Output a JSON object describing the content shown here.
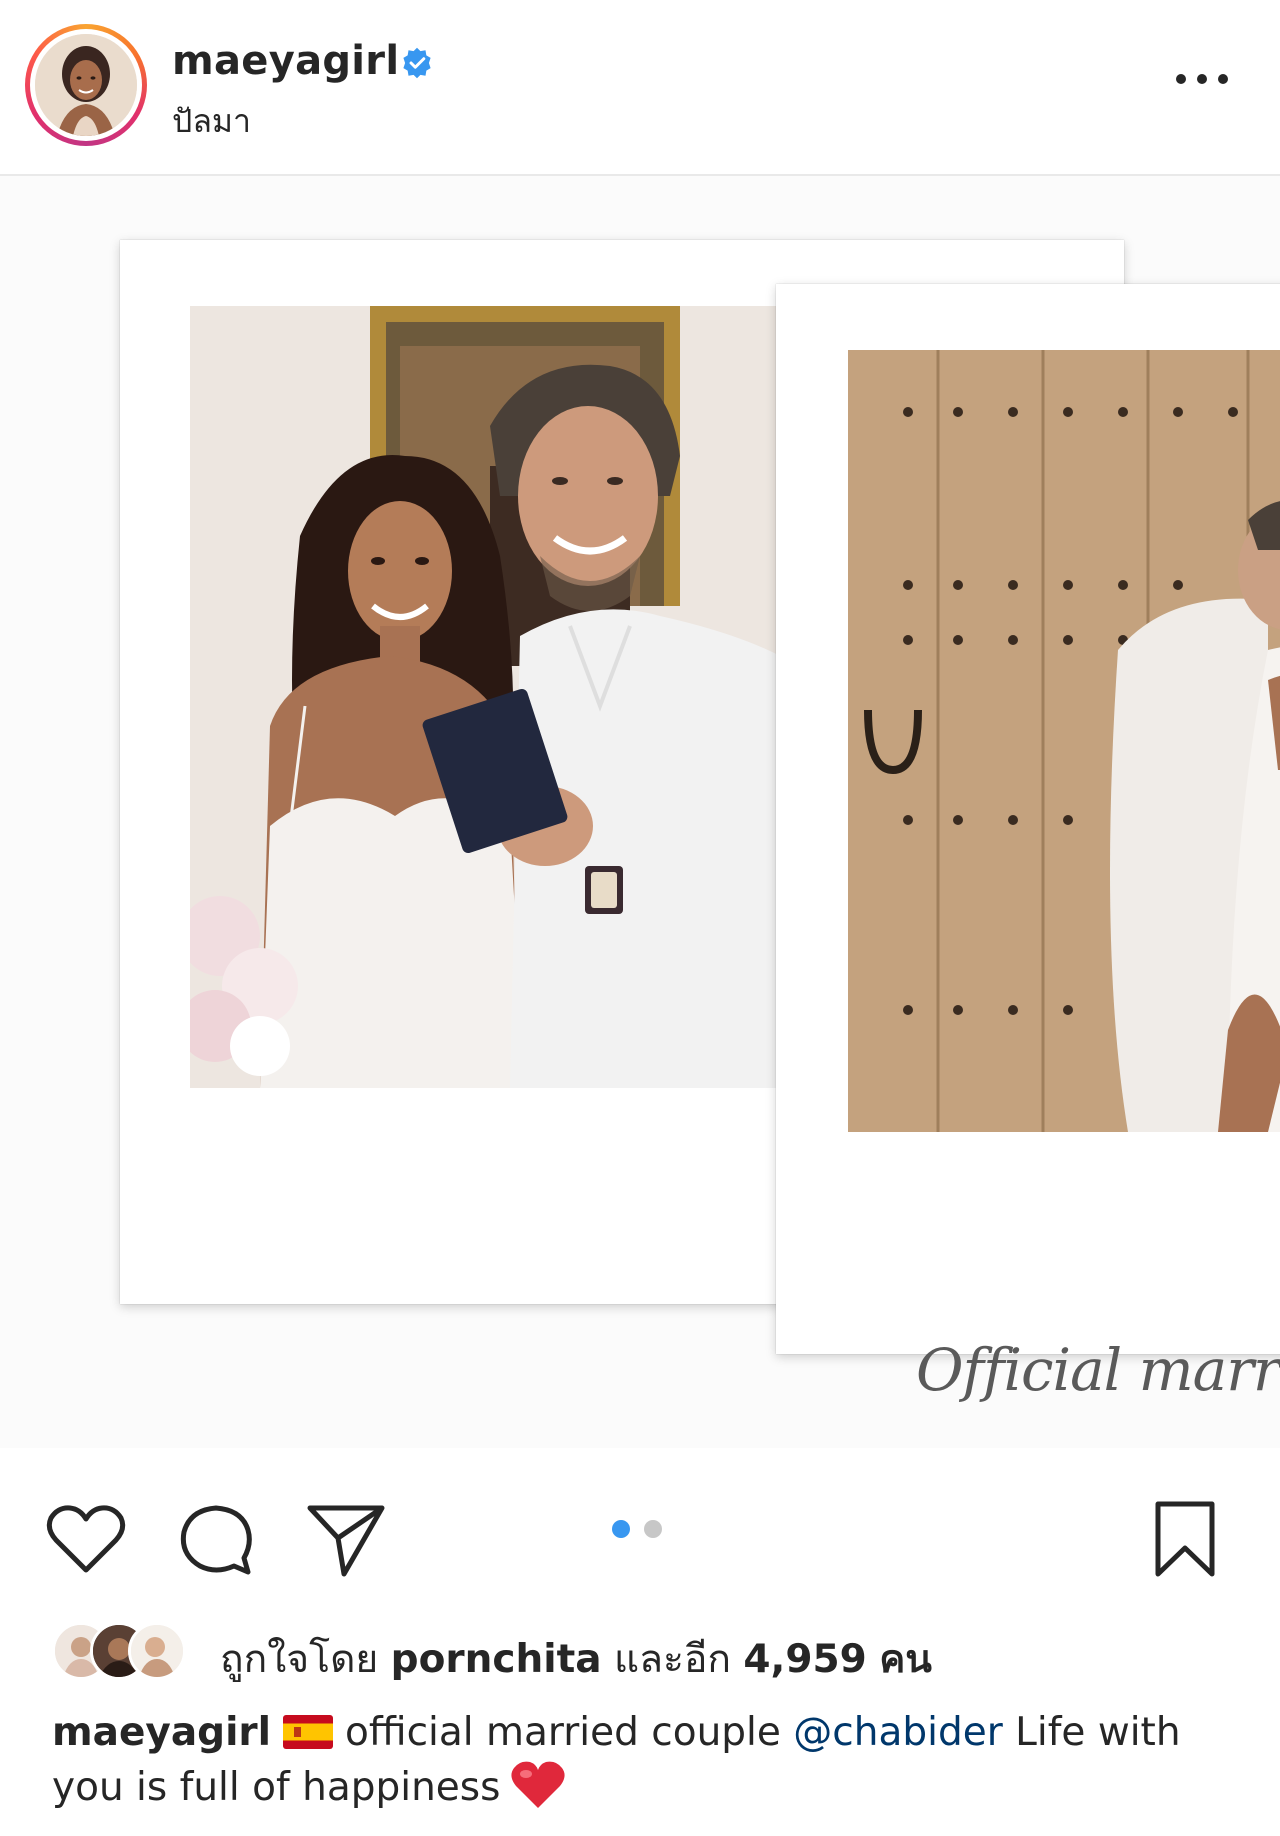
{
  "header": {
    "username": "maeyagirl",
    "location": "ปัลมา"
  },
  "media": {
    "overlay_text": "Official marri",
    "slide_index": 1,
    "slide_count": 2
  },
  "icons": {
    "like": "heart-icon",
    "comment": "comment-icon",
    "share": "paper-plane-icon",
    "save": "bookmark-icon",
    "more": "more-options-icon",
    "verified": "verified-badge-icon"
  },
  "likes": {
    "prefix": "ถูกใจโดย",
    "user": "pornchita",
    "middle": "และอีก",
    "count": "4,959",
    "suffix": "คน"
  },
  "caption": {
    "username": "maeyagirl",
    "text_before_mention": "official married couple",
    "mention": "@chabider",
    "text_after_mention": "Life with you is full of happiness"
  },
  "colors": {
    "verified_blue": "#3897f0",
    "active_dot": "#3897f0",
    "inactive_dot": "#c7c7c7",
    "mention": "#00376b",
    "text": "#262626",
    "heart_emoji": "#e0283b"
  }
}
